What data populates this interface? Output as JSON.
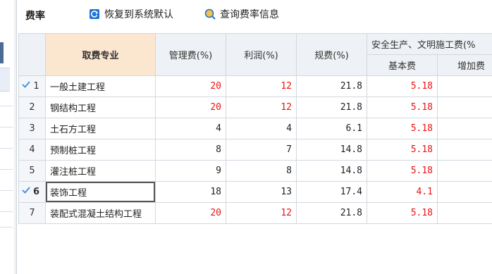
{
  "toolbar": {
    "title": "费率",
    "restore_label": "恢复到系统默认",
    "query_label": "查询费率信息",
    "restore_color": "#1e73d6",
    "query_color": "#1e73d6"
  },
  "table": {
    "header": {
      "major": "取费专业",
      "mgmt": "管理费(%)",
      "profit": "利润(%)",
      "regulatory": "规费(%)",
      "safety_group": "安全生产、文明施工费(%",
      "safety_base": "基本费",
      "safety_extra": "增加费"
    },
    "rows": [
      {
        "no": "1",
        "checked": true,
        "major": "一般土建工程",
        "mgmt": "20",
        "profit": "12",
        "regulatory": "21.8",
        "base": "5.18",
        "extra": ""
      },
      {
        "no": "2",
        "checked": false,
        "major": "钢结构工程",
        "mgmt": "20",
        "profit": "12",
        "regulatory": "21.8",
        "base": "5.18",
        "extra": ""
      },
      {
        "no": "3",
        "checked": false,
        "major": "土石方工程",
        "mgmt": "4",
        "profit": "4",
        "regulatory": "6.1",
        "base": "5.18",
        "extra": ""
      },
      {
        "no": "4",
        "checked": false,
        "major": "预制桩工程",
        "mgmt": "8",
        "profit": "7",
        "regulatory": "14.8",
        "base": "5.18",
        "extra": ""
      },
      {
        "no": "5",
        "checked": false,
        "major": "灌注桩工程",
        "mgmt": "9",
        "profit": "8",
        "regulatory": "14.8",
        "base": "5.18",
        "extra": ""
      },
      {
        "no": "6",
        "checked": true,
        "major": "装饰工程",
        "mgmt": "18",
        "profit": "13",
        "regulatory": "17.4",
        "base": "4.1",
        "extra": ""
      },
      {
        "no": "7",
        "checked": false,
        "major": "装配式混凝土结构工程",
        "mgmt": "20",
        "profit": "12",
        "regulatory": "21.8",
        "base": "5.18",
        "extra": ""
      }
    ],
    "red_color": "#e11111",
    "check_color": "#3a8ee6"
  }
}
